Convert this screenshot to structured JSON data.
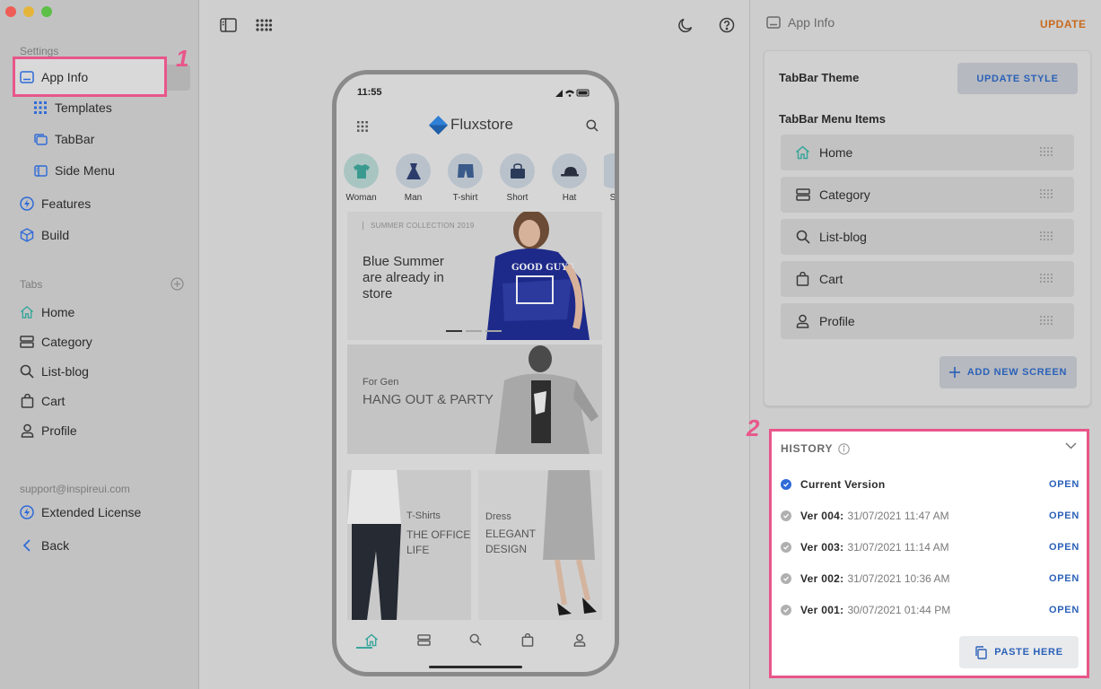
{
  "sidebar": {
    "settings_label": "Settings",
    "settings_items": [
      {
        "label": "App Info",
        "icon": "app-info-icon"
      },
      {
        "label": "Templates",
        "icon": "grid-icon"
      },
      {
        "label": "TabBar",
        "icon": "tabbar-icon"
      },
      {
        "label": "Side Menu",
        "icon": "side-menu-icon"
      }
    ],
    "main_items": [
      {
        "label": "Features",
        "icon": "bolt-icon"
      },
      {
        "label": "Build",
        "icon": "cube-icon"
      }
    ],
    "tabs_label": "Tabs",
    "tabs": [
      {
        "label": "Home",
        "icon": "home-icon"
      },
      {
        "label": "Category",
        "icon": "category-icon"
      },
      {
        "label": "List-blog",
        "icon": "search-icon"
      },
      {
        "label": "Cart",
        "icon": "bag-icon"
      },
      {
        "label": "Profile",
        "icon": "user-icon"
      }
    ],
    "support_email": "support@inspireui.com",
    "extended_license": "Extended License",
    "back": "Back"
  },
  "annotations": [
    "1",
    "2"
  ],
  "phone": {
    "time": "11:55",
    "brand": "Fluxstore",
    "categories": [
      "Woman",
      "Man",
      "T-shirt",
      "Short",
      "Hat",
      "S"
    ],
    "banner1": {
      "caption": "SUMMER COLLECTION 2019",
      "title_lines": [
        "Blue Summer",
        "are already in",
        "store"
      ]
    },
    "banner2": {
      "sub": "For Gen",
      "title": "HANG OUT & PARTY"
    },
    "banner3_left": {
      "sub": "T-Shirts",
      "title_lines": [
        "THE OFFICE",
        "LIFE"
      ]
    },
    "banner3_right": {
      "sub": "Dress",
      "title_lines": [
        "ELEGANT",
        "DESIGN"
      ]
    }
  },
  "right_panel": {
    "title": "App Info",
    "update": "UPDATE",
    "tabbar_theme": "TabBar Theme",
    "update_style": "UPDATE STYLE",
    "menu_items_title": "TabBar Menu Items",
    "menu_items": [
      {
        "label": "Home",
        "icon": "home-icon"
      },
      {
        "label": "Category",
        "icon": "category-icon"
      },
      {
        "label": "List-blog",
        "icon": "search-icon"
      },
      {
        "label": "Cart",
        "icon": "bag-icon"
      },
      {
        "label": "Profile",
        "icon": "user-icon"
      }
    ],
    "add_new_screen": "ADD NEW SCREEN",
    "history": {
      "title": "HISTORY",
      "rows": [
        {
          "name": "Current Version",
          "date": "",
          "action": "OPEN"
        },
        {
          "name": "Ver 004:",
          "date": "31/07/2021 11:47 AM",
          "action": "OPEN"
        },
        {
          "name": "Ver 003:",
          "date": "31/07/2021 11:14 AM",
          "action": "OPEN"
        },
        {
          "name": "Ver 002:",
          "date": "31/07/2021 10:36 AM",
          "action": "OPEN"
        },
        {
          "name": "Ver 001:",
          "date": "30/07/2021 01:44 PM",
          "action": "OPEN"
        }
      ],
      "paste_here": "PASTE HERE"
    }
  },
  "colors": {
    "accent_blue": "#2b61b8",
    "highlight_pink": "#e8568a",
    "update_orange": "#c86a1e",
    "teal": "#3aa69b"
  }
}
